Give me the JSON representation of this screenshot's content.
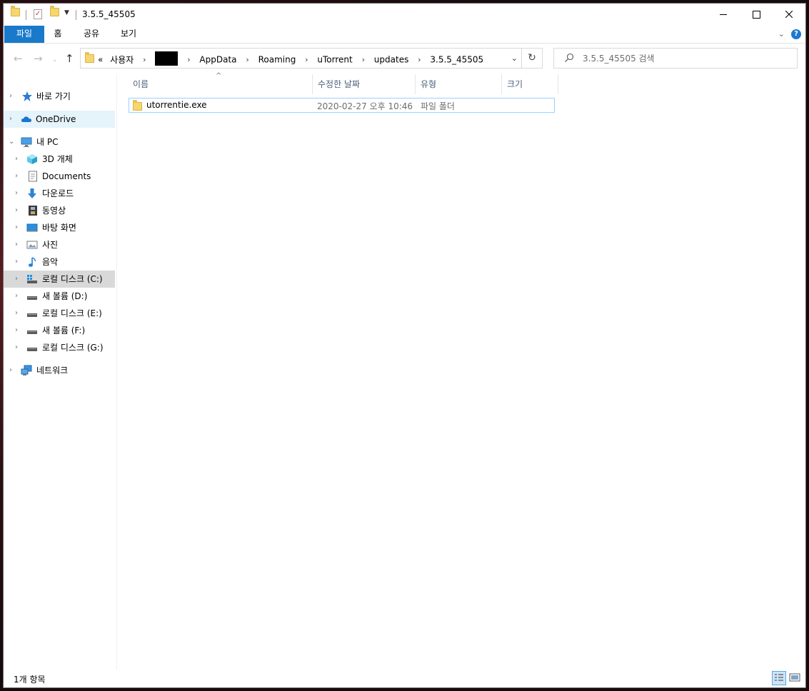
{
  "window": {
    "title": "3.5.5_45505",
    "quick_access_icons": [
      "folder-icon",
      "properties-check-icon",
      "new-folder-icon",
      "customize-dropdown-icon"
    ]
  },
  "ribbon": {
    "tabs": [
      "파일",
      "홈",
      "공유",
      "보기"
    ],
    "help_label": "?"
  },
  "address_bar": {
    "overflow_label": "«",
    "crumbs": [
      "사용자",
      "",
      "AppData",
      "Roaming",
      "uTorrent",
      "updates",
      "3.5.5_45505"
    ]
  },
  "search": {
    "placeholder": "3.5.5_45505 검색"
  },
  "nav_pane": {
    "quick_access": "바로 가기",
    "onedrive": "OneDrive",
    "this_pc": "내 PC",
    "pc_items": [
      "3D 개체",
      "Documents",
      "다운로드",
      "동영상",
      "바탕 화면",
      "사진",
      "음악",
      "로컬 디스크 (C:)",
      "새 볼륨 (D:)",
      "로컬 디스크 (E:)",
      "새 볼륨 (F:)",
      "로컬 디스크 (G:)"
    ],
    "network": "네트워크"
  },
  "file_list": {
    "columns": [
      "이름",
      "수정한 날짜",
      "유형",
      "크기"
    ],
    "rows": [
      {
        "name": "utorrentie.exe",
        "modified": "2020-02-27 오후 10:46",
        "type": "파일 폴더",
        "size": ""
      }
    ]
  },
  "status_bar": {
    "item_count": "1개 항목"
  },
  "colors": {
    "file_tab": "#1979ca",
    "selection_border": "#99d1ff",
    "header_text": "#4c607a"
  }
}
